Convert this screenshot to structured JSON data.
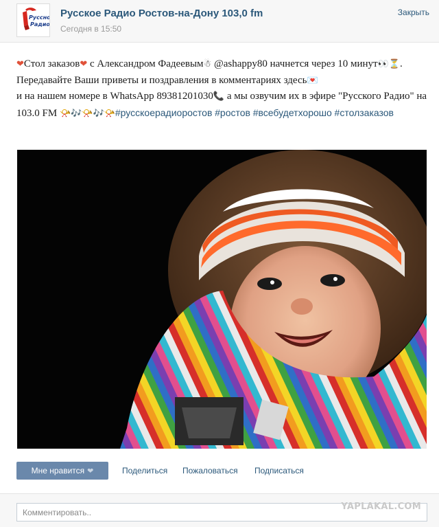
{
  "header": {
    "group_name": "Русское Радио Ростов-на-Дону 103,0 fm",
    "post_time": "Сегодня в 15:50",
    "close_label": "Закрыть",
    "avatar_logo_text": "РУССКОЕ РАДИО"
  },
  "post": {
    "heart_emoji": "❤",
    "part1": "Стол заказов",
    "part2": " с Александром Фадеевым",
    "snowman_emoji": "☃",
    "part3": " @ashappy80 начнется через 10 минут",
    "eyes_emoji": "👀",
    "hourglass_emoji": "⏳",
    "part4": ". Передавайте Ваши приветы и поздравления в комментариях здесь",
    "love_letter_emoji": "💌",
    "part5": "и на нашем номере в WhatsApp 89381201030",
    "phone_emoji": "📞",
    "part6": "  а мы озвучим их в эфире \"Русского Радио\" на 103.0 FM ",
    "music_emojis": "📯🎶📯🎶📯",
    "hashtags": [
      "#русскоерадиоростов",
      "#ростов",
      "#всебудетхорошо",
      "#столзаказов"
    ]
  },
  "actions": {
    "like_label": "Мне нравится",
    "like_icon": "heart-icon",
    "share_label": "Поделиться",
    "report_label": "Пожаловаться",
    "subscribe_label": "Подписаться"
  },
  "comment": {
    "placeholder": "Комментировать.."
  },
  "watermark": "YAPLAKAL.COM",
  "colors": {
    "link": "#2b587a",
    "like_button": "#6a88ab",
    "time": "#999999",
    "header_bg": "#f7f7f7"
  }
}
